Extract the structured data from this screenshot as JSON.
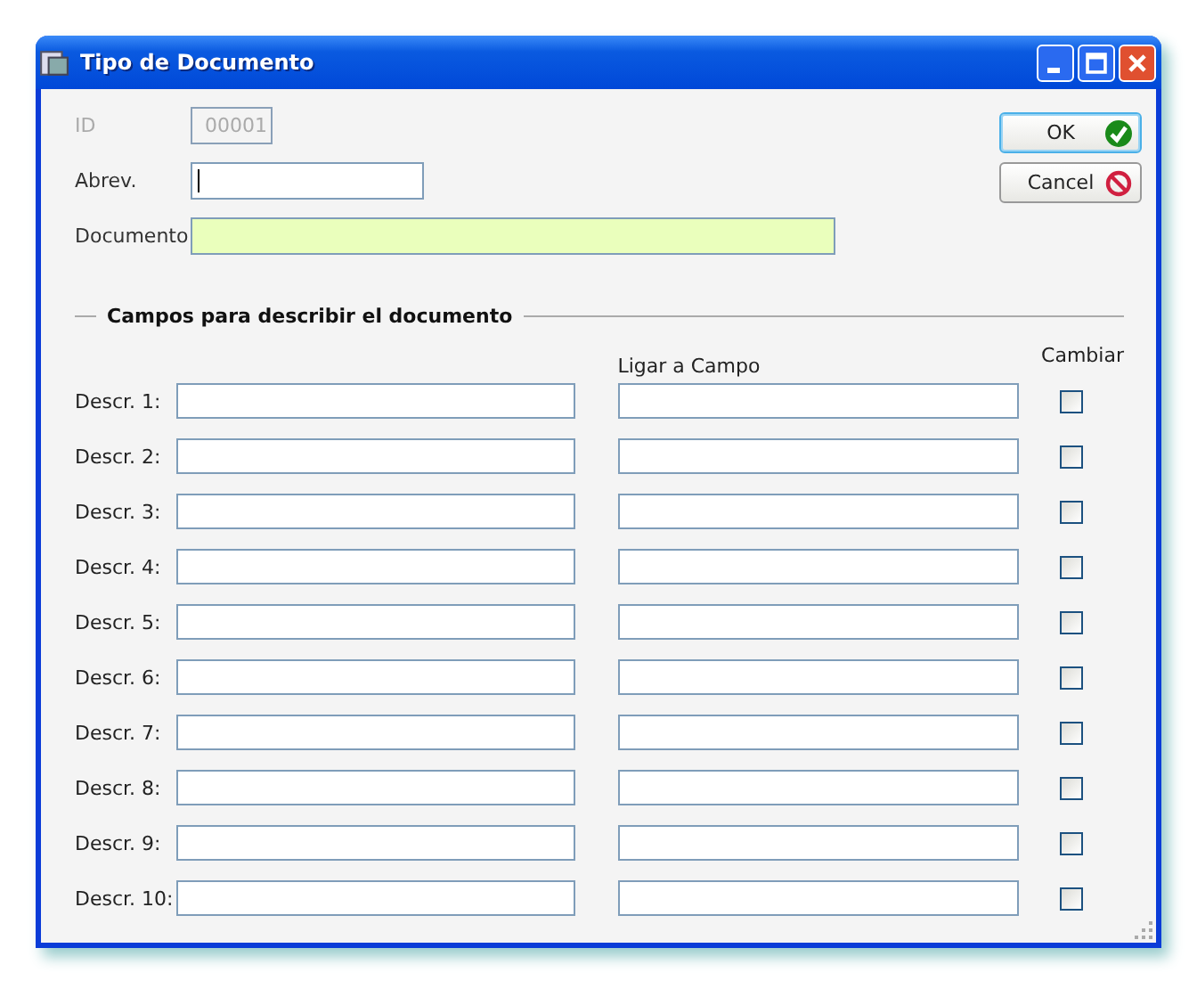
{
  "window": {
    "title": "Tipo de Documento"
  },
  "id_field": {
    "label": "ID",
    "value": "00001",
    "disabled": true
  },
  "abrev_field": {
    "label": "Abrev.",
    "focused": true
  },
  "documento_field": {
    "label": "Documento",
    "highlighted": true
  },
  "buttons": [
    {
      "label": "OK",
      "kind": "ok",
      "default": true
    },
    {
      "label": "Cancel",
      "kind": "cancel",
      "default": false
    }
  ],
  "group": {
    "title": "Campos para describir el documento",
    "column_2": "Ligar a Campo",
    "column_3": "Cambiar"
  },
  "rows": [
    {
      "label": "Descr. 1:",
      "checked": false
    },
    {
      "label": "Descr. 2:",
      "checked": false
    },
    {
      "label": "Descr. 3:",
      "checked": false
    },
    {
      "label": "Descr. 4:",
      "checked": false
    },
    {
      "label": "Descr. 5:",
      "checked": false
    },
    {
      "label": "Descr. 6:",
      "checked": false
    },
    {
      "label": "Descr. 7:",
      "checked": false
    },
    {
      "label": "Descr. 8:",
      "checked": false
    },
    {
      "label": "Descr. 9:",
      "checked": false
    },
    {
      "label": "Descr. 10:",
      "checked": false
    }
  ]
}
